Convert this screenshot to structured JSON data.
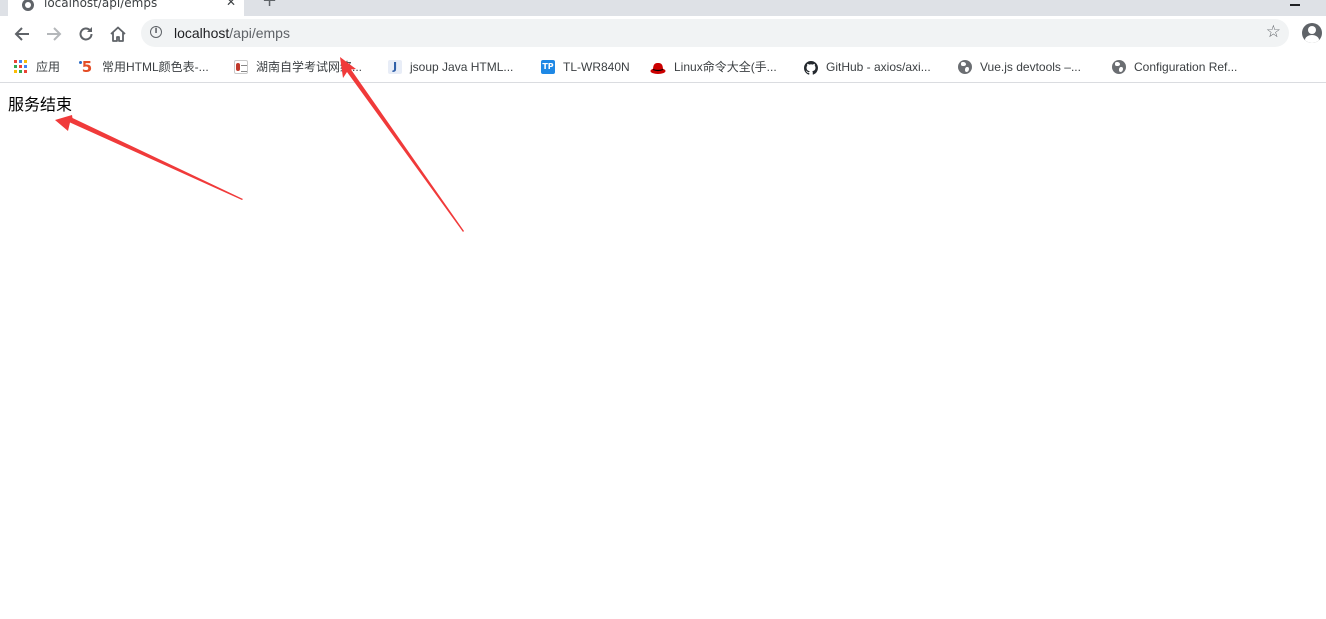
{
  "tab": {
    "title": "localhost/api/emps",
    "close_glyph": "✕",
    "new_tab_glyph": "+"
  },
  "address_bar": {
    "host": "localhost",
    "path": "/api/emps"
  },
  "bookmarks": [
    {
      "label": "应用",
      "icon": "apps-grid-icon"
    },
    {
      "label": "常用HTML颜色表-...",
      "icon": "html5-icon"
    },
    {
      "label": "湖南自学考试网络...",
      "icon": "hunan-exam-icon"
    },
    {
      "label": "jsoup Java HTML...",
      "icon": "jsoup-icon"
    },
    {
      "label": "TL-WR840N",
      "icon": "tplink-icon"
    },
    {
      "label": "Linux命令大全(手...",
      "icon": "redhat-icon"
    },
    {
      "label": "GitHub - axios/axi...",
      "icon": "github-icon"
    },
    {
      "label": "Vue.js devtools –...",
      "icon": "globe-icon"
    },
    {
      "label": "Configuration Ref...",
      "icon": "globe-icon"
    }
  ],
  "page": {
    "message": "服务结束"
  },
  "colors": {
    "annotation_arrow": "#f03a3a",
    "tab_strip": "#dee1e6",
    "omnibox": "#f1f3f4"
  }
}
